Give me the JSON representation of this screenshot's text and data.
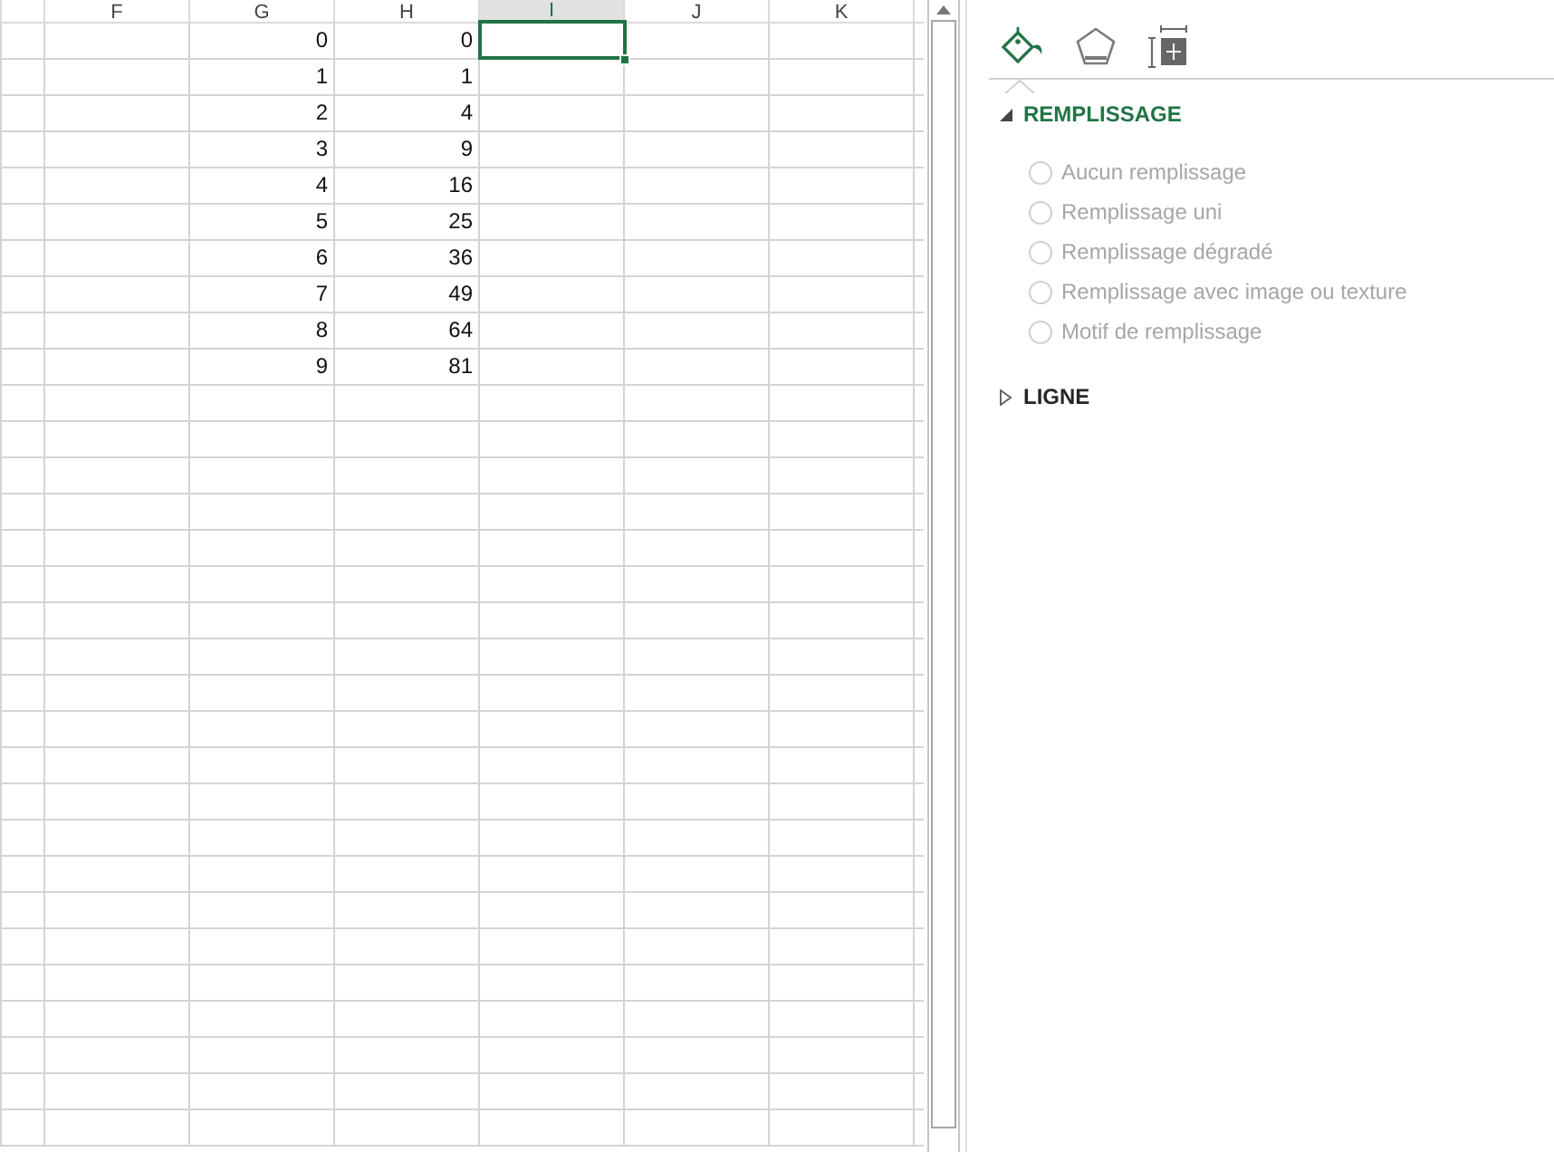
{
  "sheet": {
    "columns": [
      {
        "label": "F",
        "selected": false
      },
      {
        "label": "G",
        "selected": false
      },
      {
        "label": "H",
        "selected": false
      },
      {
        "label": "I",
        "selected": true
      },
      {
        "label": "J",
        "selected": false
      },
      {
        "label": "K",
        "selected": false
      }
    ],
    "rows": [
      {
        "selected": true,
        "cells": [
          null,
          "0",
          "0",
          null,
          null,
          null
        ]
      },
      {
        "selected": false,
        "cells": [
          null,
          "1",
          "1",
          null,
          null,
          null
        ]
      },
      {
        "selected": false,
        "cells": [
          null,
          "2",
          "4",
          null,
          null,
          null
        ]
      },
      {
        "selected": false,
        "cells": [
          null,
          "3",
          "9",
          null,
          null,
          null
        ]
      },
      {
        "selected": false,
        "cells": [
          null,
          "4",
          "16",
          null,
          null,
          null
        ]
      },
      {
        "selected": false,
        "cells": [
          null,
          "5",
          "25",
          null,
          null,
          null
        ]
      },
      {
        "selected": false,
        "cells": [
          null,
          "6",
          "36",
          null,
          null,
          null
        ]
      },
      {
        "selected": false,
        "cells": [
          null,
          "7",
          "49",
          null,
          null,
          null
        ]
      },
      {
        "selected": false,
        "cells": [
          null,
          "8",
          "64",
          null,
          null,
          null
        ]
      },
      {
        "selected": false,
        "cells": [
          null,
          "9",
          "81",
          null,
          null,
          null
        ]
      }
    ]
  },
  "format_pane": {
    "icon_tabs": [
      {
        "kind": "fill",
        "selected": true
      },
      {
        "kind": "effects",
        "selected": false
      },
      {
        "kind": "size",
        "selected": false
      }
    ],
    "sections": [
      {
        "title": "REMPLISSAGE",
        "expanded": true,
        "options": [
          {
            "label": "Aucun remplissage",
            "selected": false,
            "disabled": true
          },
          {
            "label": "Remplissage uni",
            "selected": false,
            "disabled": true
          },
          {
            "label": "Remplissage dégradé",
            "selected": false,
            "disabled": true
          },
          {
            "label": "Remplissage avec image ou texture",
            "selected": false,
            "disabled": true
          },
          {
            "label": "Motif de remplissage",
            "selected": false,
            "disabled": true
          }
        ]
      },
      {
        "title": "LIGNE",
        "expanded": false
      }
    ]
  }
}
